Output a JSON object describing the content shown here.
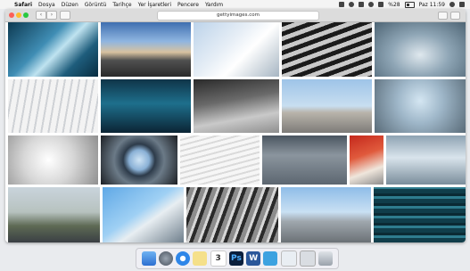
{
  "menubar": {
    "apple": "",
    "items": [
      "Safari",
      "Dosya",
      "Düzen",
      "Görüntü",
      "Tarihçe",
      "Yer İşaretleri",
      "Pencere",
      "Yardım"
    ],
    "battery": "%28",
    "clock": "Paz 11:59"
  },
  "browser": {
    "url": "gettyimages.com",
    "back_label": "‹",
    "forward_label": "›"
  },
  "dock": {
    "calendar_day": "3",
    "photoshop_label": "Ps",
    "word_label": "W"
  }
}
